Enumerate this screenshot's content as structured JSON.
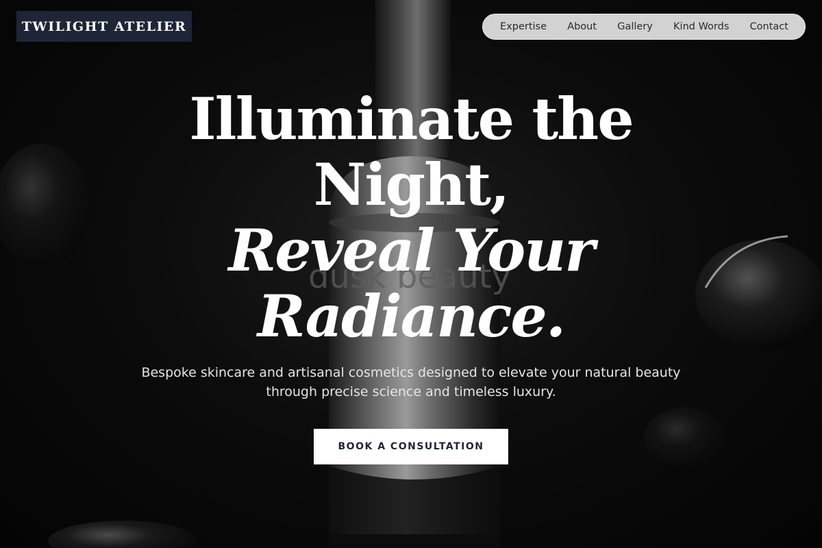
{
  "brand": {
    "name": "TWILIGHT ATELIER",
    "bg_color": "#1e2536"
  },
  "nav": {
    "items": [
      "Expertise",
      "About",
      "Gallery",
      "Kind Words",
      "Contact"
    ]
  },
  "hero": {
    "headline_lines": [
      "Illuminate the",
      "Night,"
    ],
    "headline_italic_lines": [
      "Reveal Your",
      "Radiance."
    ],
    "subtitle_lines": [
      "Bespoke skincare and artisanal cosmetics designed to elevate your natural beauty",
      "through precise science and timeless luxury."
    ],
    "cta_label": "BOOK A CONSULTATION",
    "product_engraving": "dusk beauty"
  },
  "colors": {
    "accent": "#1e2536",
    "background": "#050505",
    "text": "#ffffff"
  }
}
